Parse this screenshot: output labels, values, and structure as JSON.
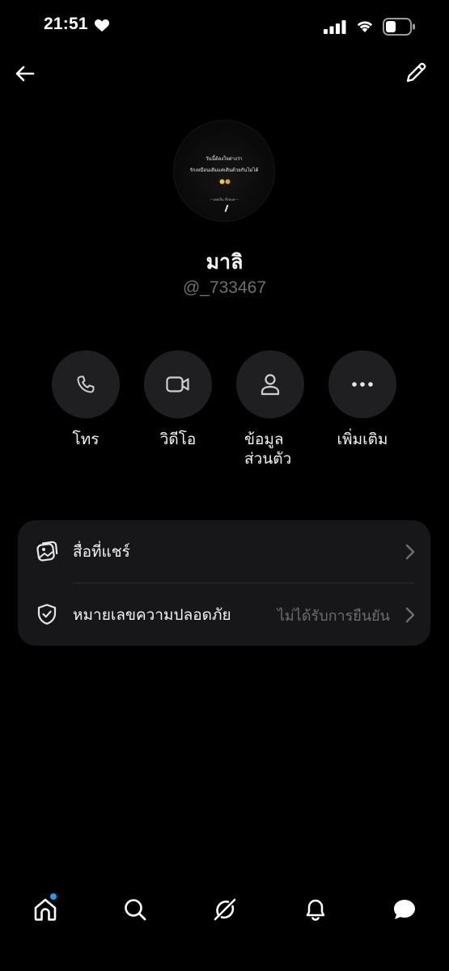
{
  "status_bar": {
    "time": "21:51"
  },
  "avatar": {
    "line1": "วันนี้ต้องใจต่างว่า",
    "line2": "รักเหมือนเดิมแค่เดินด้วยกันไม่ได้",
    "signature": "—เคยเป็น ทั้งหมด—"
  },
  "profile": {
    "display_name": "มาลิ",
    "username": "@_733467"
  },
  "actions": [
    {
      "label": "โทร",
      "icon": "phone-icon"
    },
    {
      "label": "วิดีโอ",
      "icon": "video-icon"
    },
    {
      "label": "ข้อมูล\nส่วนตัว",
      "line1": "ข้อมูล",
      "line2": "ส่วนตัว",
      "icon": "person-icon"
    },
    {
      "label": "เพิ่มเติม",
      "icon": "more-icon"
    }
  ],
  "menu": {
    "shared_media": {
      "label": "สื่อที่แชร์",
      "icon": "media-icon"
    },
    "safety_number": {
      "label": "หมายเลขความปลอดภัย",
      "value": "ไม่ได้รับการยืนยัน",
      "icon": "shield-check-icon"
    }
  },
  "tab_bar": {
    "items": [
      "home-icon",
      "search-icon",
      "grok-icon",
      "notifications-icon",
      "messages-icon"
    ],
    "home_has_badge": true
  },
  "colors": {
    "accent": "#1d9bf0",
    "background": "#000000",
    "card": "#17171a",
    "muted": "#6f6f6f"
  }
}
